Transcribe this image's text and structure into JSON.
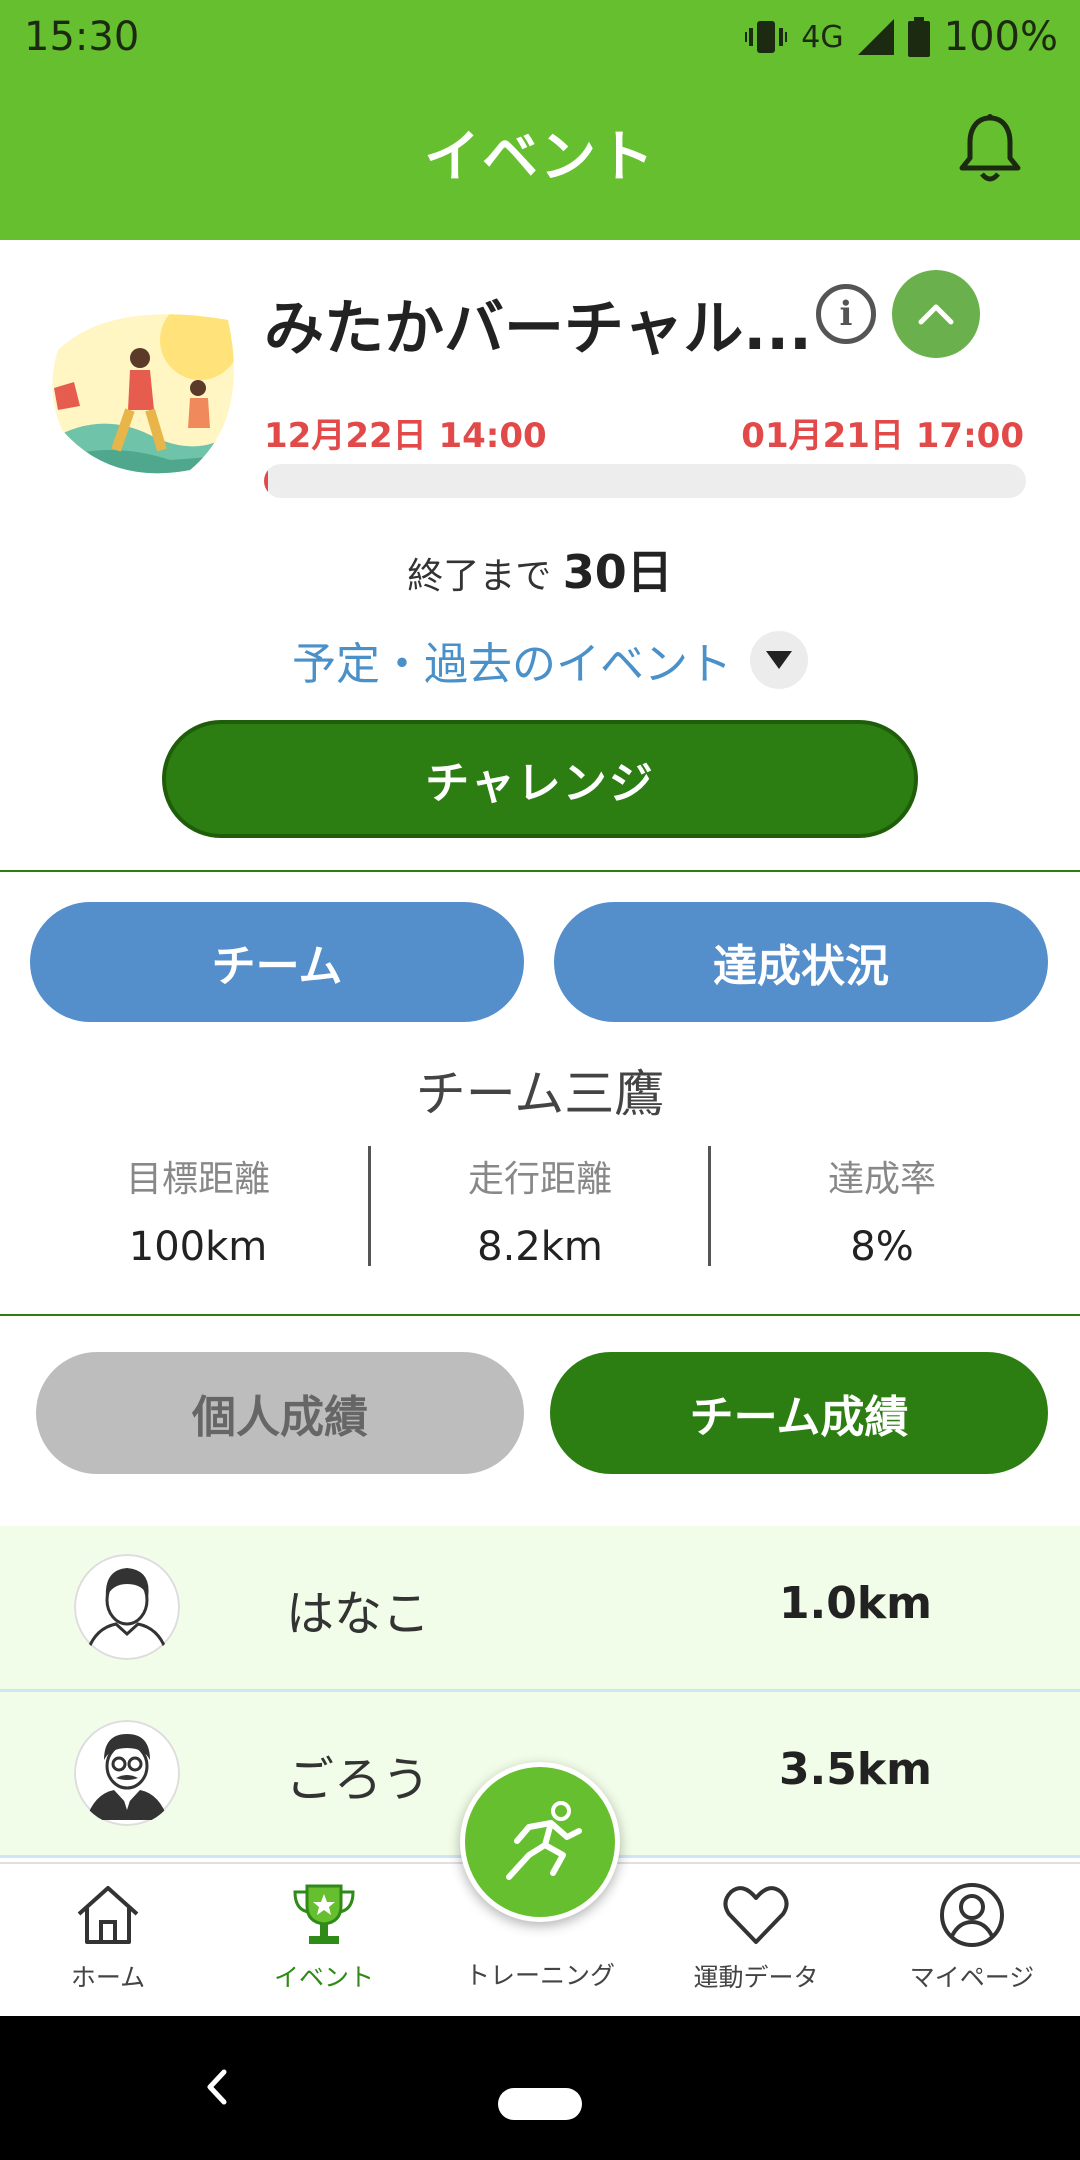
{
  "status_bar": {
    "time": "15:30",
    "network": "4G",
    "battery": "100%"
  },
  "app_bar": {
    "title": "イベント"
  },
  "event": {
    "title": "みたかバーチャル...",
    "start": "12月22日 14:00",
    "end": "01月21日 17:00",
    "progress_fraction": 0.005,
    "remaining_label": "終了まで",
    "remaining_value": "30日",
    "past_events_link": "予定・過去のイベント",
    "challenge_label": "チャレンジ"
  },
  "team_section": {
    "team_button": "チーム",
    "progress_button": "達成状況",
    "team_name": "チーム三鷹",
    "stats": [
      {
        "label": "目標距離",
        "value": "100km"
      },
      {
        "label": "走行距離",
        "value": "8.2km"
      },
      {
        "label": "達成率",
        "value": "8%"
      }
    ]
  },
  "results_toggle": {
    "personal": "個人成績",
    "team": "チーム成績",
    "selected": "team"
  },
  "members": [
    {
      "name": "はなこ",
      "distance": "1.0km"
    },
    {
      "name": "ごろう",
      "distance": "3.5km"
    }
  ],
  "bottom_nav": {
    "items": [
      {
        "label": "ホーム",
        "icon": "home-icon"
      },
      {
        "label": "イベント",
        "icon": "trophy-icon",
        "active": true
      },
      {
        "label": "トレーニング",
        "icon": "runner-icon"
      },
      {
        "label": "運動データ",
        "icon": "heart-icon"
      },
      {
        "label": "マイページ",
        "icon": "user-icon"
      }
    ]
  },
  "colors": {
    "brand_green": "#66bf2e",
    "dark_green": "#2c7e12",
    "accent_red": "#e24a4a",
    "blue": "#548fcc"
  }
}
